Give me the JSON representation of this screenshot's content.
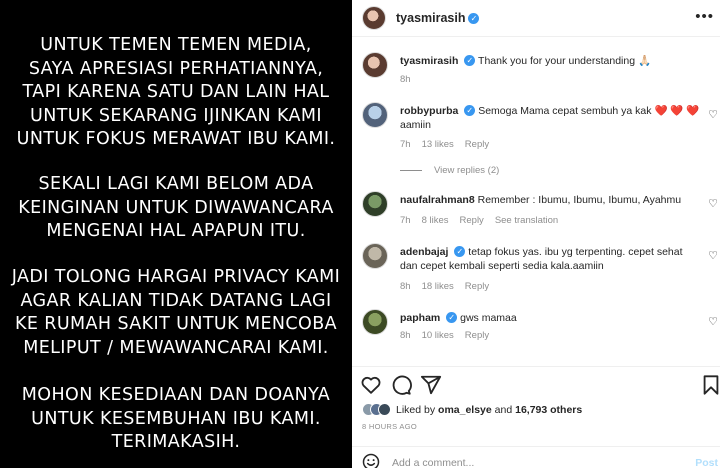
{
  "media": {
    "paragraphs": [
      "UNTUK TEMEN TEMEN MEDIA,\nSAYA APRESIASI PERHATIANNYA,\nTAPI KARENA SATU DAN LAIN HAL\nUNTUK SEKARANG IJINKAN KAMI\nUNTUK FOKUS MERAWAT IBU KAMI.",
      "SEKALI LAGI KAMI BELOM ADA\nKEINGINAN UNTUK DIWAWANCARA\nMENGENAI HAL APAPUN ITU.",
      "JADI TOLONG HARGAI PRIVACY KAMI\nAGAR KALIAN TIDAK DATANG LAGI\nKE RUMAH SAKIT UNTUK MENCOBA\nMELIPUT / MEWAWANCARAI KAMI.",
      "MOHON KESEDIAAN DAN DOANYA\nUNTUK KESEMBUHAN IBU KAMI.\nTERIMAKASIH."
    ]
  },
  "header": {
    "username": "tyasmirasih",
    "more": "•••"
  },
  "caption": {
    "username": "tyasmirasih",
    "text": "Thank you for your understanding 🙏🏻",
    "time": "8h"
  },
  "comments": [
    {
      "username": "robbypurba",
      "verified": true,
      "text": "Semoga Mama cepat sembuh ya kak ❤️ ❤️ ❤️ aamiin",
      "time": "7h",
      "likes": "13 likes",
      "reply": "Reply",
      "view_replies": "View replies (2)"
    },
    {
      "username": "naufalrahman8",
      "verified": false,
      "text": "Remember : Ibumu, Ibumu, Ibumu, Ayahmu",
      "time": "7h",
      "likes": "8 likes",
      "reply": "Reply",
      "translation": "See translation"
    },
    {
      "username": "adenbajaj",
      "verified": true,
      "text": "tetap fokus yas. ibu yg terpenting. cepet sehat dan cepet kembali seperti sedia kala.aamiin",
      "time": "8h",
      "likes": "18 likes",
      "reply": "Reply"
    },
    {
      "username": "papham",
      "verified": true,
      "text": "gws mamaa",
      "time": "8h",
      "likes": "10 likes",
      "reply": "Reply"
    }
  ],
  "likes": {
    "prefix": "Liked by ",
    "user": "oma_elsye",
    "middle": " and ",
    "count": "16,793 others"
  },
  "timestamp": "8 HOURS AGO",
  "add_comment": {
    "placeholder": "Add a comment...",
    "post": "Post"
  },
  "icons": {
    "heart": "heart-icon",
    "comment": "comment-icon",
    "share": "share-icon",
    "save": "bookmark-icon",
    "emoji": "emoji-icon"
  }
}
